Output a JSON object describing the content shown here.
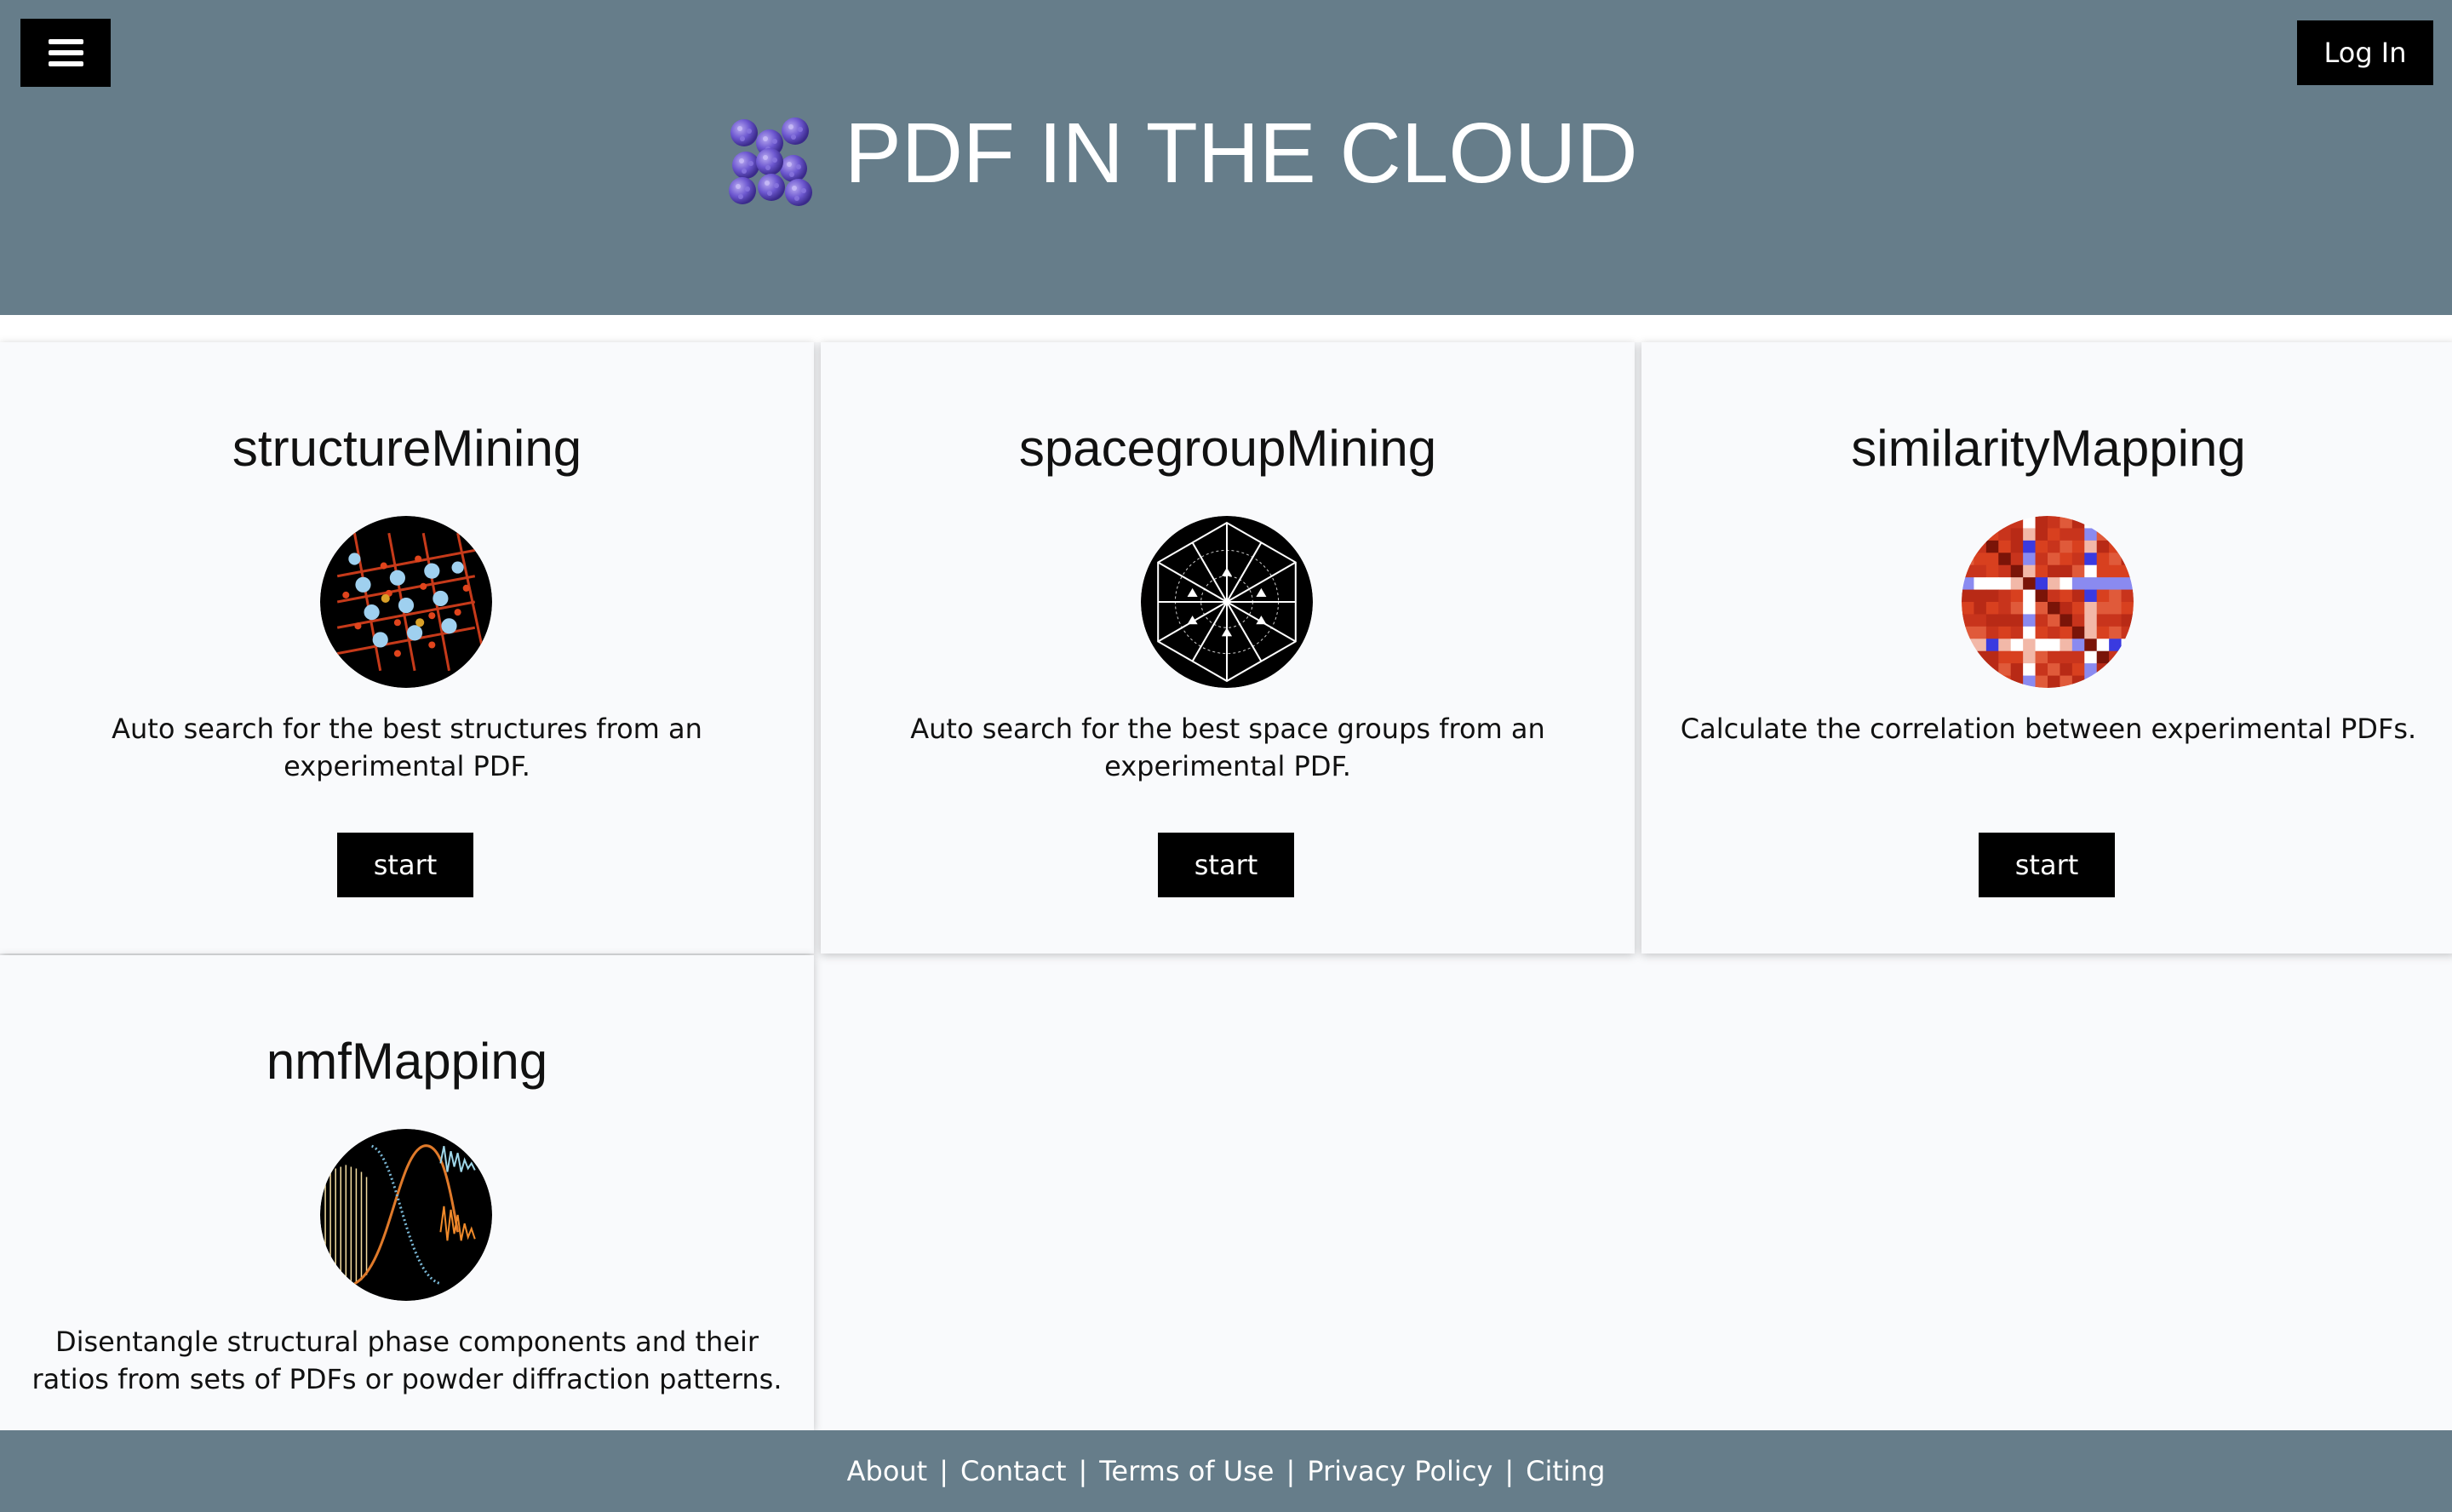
{
  "header": {
    "menu_icon": "hamburger-menu-icon",
    "login_label": "Log In",
    "logo_icon": "molecule-cluster-icon",
    "title": "PDF IN THE CLOUD",
    "colors": {
      "background": "#667d8a",
      "button": "#000000"
    }
  },
  "cards": [
    {
      "title": "structureMining",
      "image": "crystal-structure-icon",
      "description": "Auto search for the best structures from an experimental PDF.",
      "button": "start"
    },
    {
      "title": "spacegroupMining",
      "image": "spacegroup-symmetry-icon",
      "description": "Auto search for the best space groups from an experimental PDF.",
      "button": "start"
    },
    {
      "title": "similarityMapping",
      "image": "correlation-heatmap-icon",
      "description": "Calculate the correlation between experimental PDFs.",
      "button": "start"
    },
    {
      "title": "nmfMapping",
      "image": "nmf-curves-icon",
      "description": "Disentangle structural phase components and their ratios from sets of PDFs or powder diffraction patterns."
    }
  ],
  "footer": {
    "links": [
      "About",
      "Contact",
      "Terms of Use",
      "Privacy Policy",
      "Citing"
    ],
    "separator": "|"
  }
}
